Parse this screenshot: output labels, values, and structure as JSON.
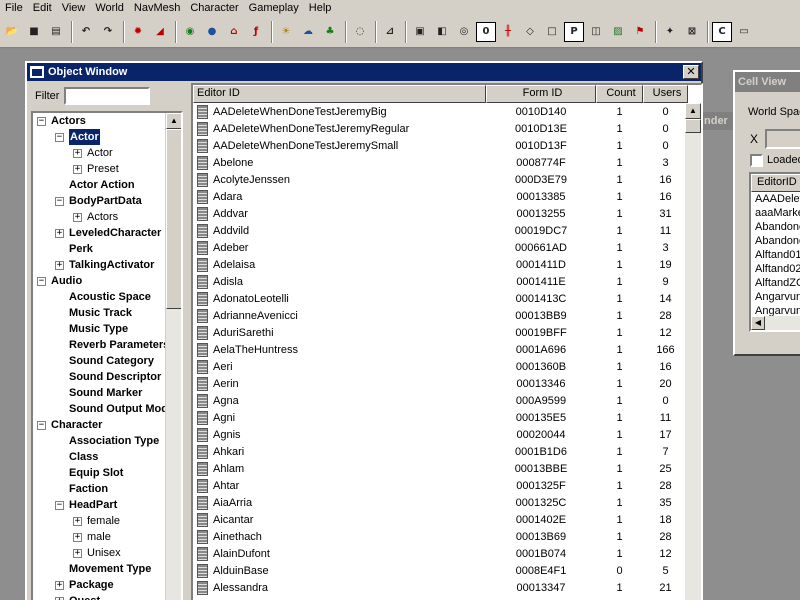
{
  "menu": [
    "File",
    "Edit",
    "View",
    "World",
    "NavMesh",
    "Character",
    "Gameplay",
    "Help"
  ],
  "toolbar": {
    "buttons": [
      "open-icon",
      "save-icon",
      "preferences-icon",
      "sep",
      "undo-icon",
      "redo-icon",
      "sep",
      "select-icon",
      "triangle-icon",
      "sep",
      "landscape-icon",
      "world-icon",
      "havok-icon",
      "fx-icon",
      "sep",
      "light-icon",
      "sky-icon",
      "grass-icon",
      "sep",
      "dialog-icon",
      "sep",
      "snap-icon",
      "sep",
      "box-icon",
      "marker-box-icon",
      "circle-marker-icon",
      "zero-icon",
      "split-icon",
      "cube-icon",
      "square-icon",
      "p-icon",
      "q-icon",
      "picture-icon",
      "flag-icon",
      "sep",
      "compass-icon",
      "x-box-icon",
      "sep",
      "c-icon",
      "window-icon"
    ],
    "labels": {
      "zero-icon": "0",
      "p-icon": "P",
      "c-icon": "C"
    }
  },
  "object_window": {
    "title": "Object Window",
    "close_glyph": "✕",
    "filter_label": "Filter",
    "filter_value": "",
    "tree": [
      {
        "label": "Actors",
        "level": 0,
        "exp": "−",
        "bold": true
      },
      {
        "label": "Actor",
        "level": 1,
        "exp": "−",
        "bold": true,
        "selected": true
      },
      {
        "label": "Actor",
        "level": 2,
        "exp": "+",
        "bold": false
      },
      {
        "label": "Preset",
        "level": 2,
        "exp": "+",
        "bold": false
      },
      {
        "label": "Actor Action",
        "level": 1,
        "exp": "",
        "bold": true
      },
      {
        "label": "BodyPartData",
        "level": 1,
        "exp": "−",
        "bold": true
      },
      {
        "label": "Actors",
        "level": 2,
        "exp": "+",
        "bold": false
      },
      {
        "label": "LeveledCharacter",
        "level": 1,
        "exp": "+",
        "bold": true
      },
      {
        "label": "Perk",
        "level": 1,
        "exp": "",
        "bold": true
      },
      {
        "label": "TalkingActivator",
        "level": 1,
        "exp": "+",
        "bold": true
      },
      {
        "label": "Audio",
        "level": 0,
        "exp": "−",
        "bold": true
      },
      {
        "label": "Acoustic Space",
        "level": 1,
        "exp": "",
        "bold": true
      },
      {
        "label": "Music Track",
        "level": 1,
        "exp": "",
        "bold": true
      },
      {
        "label": "Music Type",
        "level": 1,
        "exp": "",
        "bold": true
      },
      {
        "label": "Reverb Parameters",
        "level": 1,
        "exp": "",
        "bold": true
      },
      {
        "label": "Sound Category",
        "level": 1,
        "exp": "",
        "bold": true
      },
      {
        "label": "Sound Descriptor",
        "level": 1,
        "exp": "",
        "bold": true
      },
      {
        "label": "Sound Marker",
        "level": 1,
        "exp": "",
        "bold": true
      },
      {
        "label": "Sound Output Model",
        "level": 1,
        "exp": "",
        "bold": true
      },
      {
        "label": "Character",
        "level": 0,
        "exp": "−",
        "bold": true
      },
      {
        "label": "Association Type",
        "level": 1,
        "exp": "",
        "bold": true
      },
      {
        "label": "Class",
        "level": 1,
        "exp": "",
        "bold": true
      },
      {
        "label": "Equip Slot",
        "level": 1,
        "exp": "",
        "bold": true
      },
      {
        "label": "Faction",
        "level": 1,
        "exp": "",
        "bold": true
      },
      {
        "label": "HeadPart",
        "level": 1,
        "exp": "−",
        "bold": true
      },
      {
        "label": "female",
        "level": 2,
        "exp": "+",
        "bold": false
      },
      {
        "label": "male",
        "level": 2,
        "exp": "+",
        "bold": false
      },
      {
        "label": "Unisex",
        "level": 2,
        "exp": "+",
        "bold": false
      },
      {
        "label": "Movement Type",
        "level": 1,
        "exp": "",
        "bold": true
      },
      {
        "label": "Package",
        "level": 1,
        "exp": "+",
        "bold": true
      },
      {
        "label": "Quest",
        "level": 1,
        "exp": "+",
        "bold": true
      }
    ],
    "columns": {
      "editor_id": "Editor ID",
      "form_id": "Form ID",
      "count": "Count",
      "users": "Users"
    },
    "rows": [
      [
        "AADeleteWhenDoneTestJeremyBig",
        "0010D140",
        "1",
        "0"
      ],
      [
        "AADeleteWhenDoneTestJeremyRegular",
        "0010D13E",
        "1",
        "0"
      ],
      [
        "AADeleteWhenDoneTestJeremySmall",
        "0010D13F",
        "1",
        "0"
      ],
      [
        "Abelone",
        "0008774F",
        "1",
        "3"
      ],
      [
        "AcolyteJenssen",
        "000D3E79",
        "1",
        "16"
      ],
      [
        "Adara",
        "00013385",
        "1",
        "16"
      ],
      [
        "Addvar",
        "00013255",
        "1",
        "31"
      ],
      [
        "Addvild",
        "00019DC7",
        "1",
        "11"
      ],
      [
        "Adeber",
        "000661AD",
        "1",
        "3"
      ],
      [
        "Adelaisa",
        "0001411D",
        "1",
        "19"
      ],
      [
        "Adisla",
        "0001411E",
        "1",
        "9"
      ],
      [
        "AdonatoLeotelli",
        "0001413C",
        "1",
        "14"
      ],
      [
        "AdrianneAvenicci",
        "00013BB9",
        "1",
        "28"
      ],
      [
        "AduriSarethi",
        "00019BFF",
        "1",
        "12"
      ],
      [
        "AelaTheHuntress",
        "0001A696",
        "1",
        "166"
      ],
      [
        "Aeri",
        "0001360B",
        "1",
        "16"
      ],
      [
        "Aerin",
        "00013346",
        "1",
        "20"
      ],
      [
        "Agna",
        "000A9599",
        "1",
        "0"
      ],
      [
        "Agni",
        "000135E5",
        "1",
        "11"
      ],
      [
        "Agnis",
        "00020044",
        "1",
        "17"
      ],
      [
        "Ahkari",
        "0001B1D6",
        "1",
        "7"
      ],
      [
        "Ahlam",
        "00013BBE",
        "1",
        "25"
      ],
      [
        "Ahtar",
        "0001325F",
        "1",
        "28"
      ],
      [
        "AiaArria",
        "0001325C",
        "1",
        "35"
      ],
      [
        "Aicantar",
        "0001402E",
        "1",
        "18"
      ],
      [
        "Ainethach",
        "00013B69",
        "1",
        "28"
      ],
      [
        "AlainDufont",
        "0001B074",
        "1",
        "12"
      ],
      [
        "AlduinBase",
        "0008E4F1",
        "0",
        "5"
      ],
      [
        "Alessandra",
        "00013347",
        "1",
        "21"
      ]
    ]
  },
  "render_window": {
    "title_fragment": "nder"
  },
  "cell_view": {
    "title": "Cell View",
    "worldspace_label": "World Spac",
    "x_label": "X",
    "loaded_label": "Loaded",
    "list_header": "EditorID",
    "items": [
      "AAADelet",
      "aaaMarke",
      "Abandone",
      "Abandone",
      "Alftand01",
      "Alftand02",
      "AlftandZC",
      "Angarvun",
      "Angarvun"
    ]
  }
}
